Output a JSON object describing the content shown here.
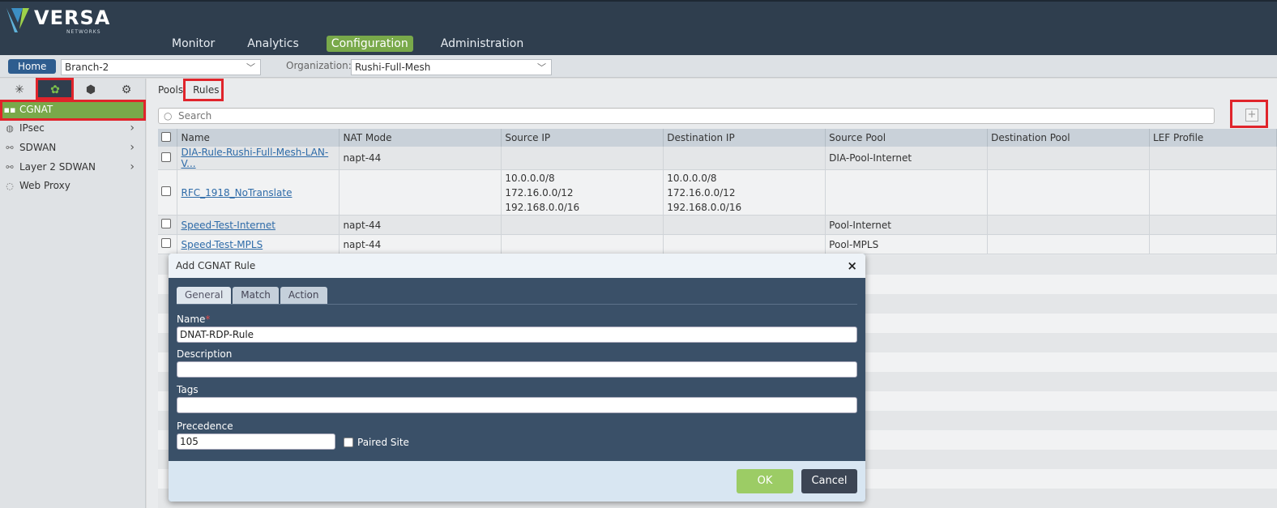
{
  "brand": {
    "name": "VERSA",
    "sub": "NETWORKS"
  },
  "nav": [
    "Monitor",
    "Analytics",
    "Configuration",
    "Administration"
  ],
  "nav_active": "Configuration",
  "appliance": {
    "home_label": "Home",
    "selected": "Branch-2",
    "org_label": "Organization:",
    "org_value": "Rushi-Full-Mesh"
  },
  "sidebar": {
    "tabs": [
      "network-icon",
      "gear-icon",
      "box-icon",
      "globe-gear-icon"
    ],
    "items": [
      {
        "label": "CGNAT",
        "icon": "cgnat-icon",
        "active": true,
        "has_children": false
      },
      {
        "label": "IPsec",
        "icon": "ipsec-icon",
        "active": false,
        "has_children": true
      },
      {
        "label": "SDWAN",
        "icon": "sdwan-icon",
        "active": false,
        "has_children": true
      },
      {
        "label": "Layer 2 SDWAN",
        "icon": "layer2-icon",
        "active": false,
        "has_children": true
      },
      {
        "label": "Web Proxy",
        "icon": "web-proxy-icon",
        "active": false,
        "has_children": false
      }
    ]
  },
  "main": {
    "tabs": [
      "Pools",
      "Rules"
    ],
    "search_placeholder": "Search",
    "add_label": "+",
    "columns": [
      "Name",
      "NAT Mode",
      "Source IP",
      "Destination IP",
      "Source Pool",
      "Destination Pool",
      "LEF Profile"
    ],
    "rows": [
      {
        "name": "DIA-Rule-Rushi-Full-Mesh-LAN-V...",
        "mode": "napt-44",
        "src": [],
        "dst": [],
        "spool": "DIA-Pool-Internet",
        "dpool": "",
        "lef": ""
      },
      {
        "name": "RFC_1918_NoTranslate",
        "mode": "",
        "src": [
          "10.0.0.0/8",
          "172.16.0.0/12",
          "192.168.0.0/16"
        ],
        "dst": [
          "10.0.0.0/8",
          "172.16.0.0/12",
          "192.168.0.0/16"
        ],
        "spool": "",
        "dpool": "",
        "lef": ""
      },
      {
        "name": "Speed-Test-Internet",
        "mode": "napt-44",
        "src": [],
        "dst": [],
        "spool": "Pool-Internet",
        "dpool": "",
        "lef": ""
      },
      {
        "name": "Speed-Test-MPLS",
        "mode": "napt-44",
        "src": [],
        "dst": [],
        "spool": "Pool-MPLS",
        "dpool": "",
        "lef": ""
      }
    ]
  },
  "dialog": {
    "title": "Add CGNAT Rule",
    "close": "×",
    "tabs": [
      "General",
      "Match",
      "Action"
    ],
    "name_label": "Name",
    "required_mark": "*",
    "name_value": "DNAT-RDP-Rule",
    "description_label": "Description",
    "description_value": "",
    "tags_label": "Tags",
    "tags_value": "",
    "precedence_label": "Precedence",
    "precedence_value": "105",
    "paired_site_label": "Paired Site",
    "ok_label": "OK",
    "cancel_label": "Cancel"
  },
  "colors": {
    "header": "#2f3e4e",
    "accent": "#79a94a",
    "highlight": "#e0242b",
    "dialog": "#3a5068"
  }
}
